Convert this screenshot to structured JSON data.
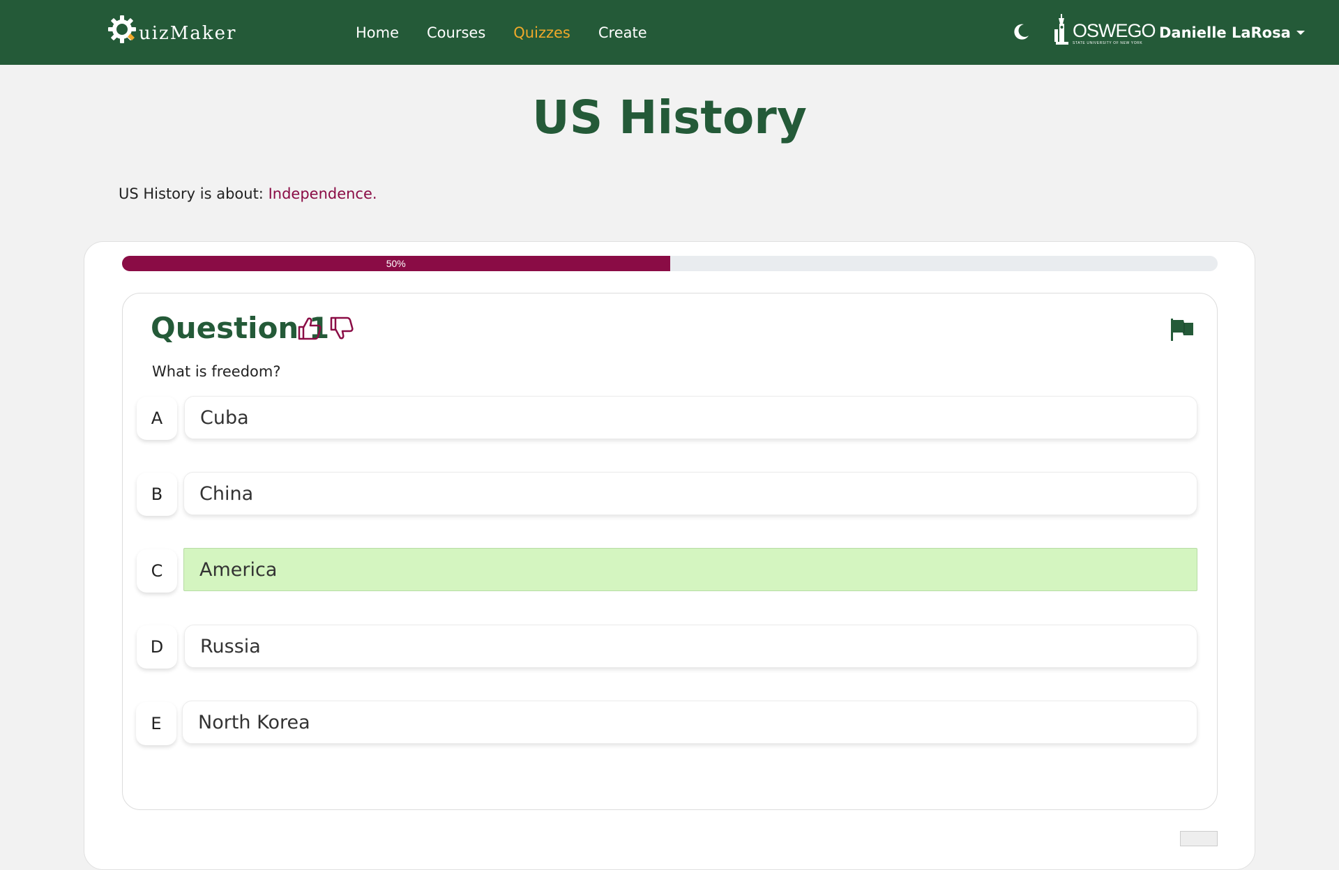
{
  "navbar": {
    "brand_initial": "Q",
    "brand_text": "uizMaker",
    "links": [
      {
        "label": "Home",
        "active": false
      },
      {
        "label": "Courses",
        "active": false
      },
      {
        "label": "Quizzes",
        "active": true
      },
      {
        "label": "Create",
        "active": false
      }
    ],
    "theme_toggle_icon": "moon-icon",
    "university": {
      "name": "OSWEGO",
      "subtitle": "STATE UNIVERSITY OF NEW YORK"
    },
    "user_name": "Danielle LaRosa"
  },
  "page": {
    "title": "US History",
    "about_prefix": "US History is about: ",
    "about_topic": "Independence."
  },
  "progress": {
    "label": "50%",
    "value": 0.5
  },
  "question": {
    "title": "Question 1",
    "text": "What is freedom?",
    "options": [
      {
        "letter": "A",
        "text": "Cuba",
        "selected": false
      },
      {
        "letter": "B",
        "text": "China",
        "selected": false
      },
      {
        "letter": "C",
        "text": "America",
        "selected": true
      },
      {
        "letter": "D",
        "text": "Russia",
        "selected": false
      },
      {
        "letter": "E",
        "text": "North Korea",
        "selected": false
      }
    ]
  },
  "colors": {
    "nav_green": "#245a38",
    "accent_maroon": "#8a0c45",
    "active_link": "#f0a92a",
    "selected_option": "#d4f5c0"
  }
}
